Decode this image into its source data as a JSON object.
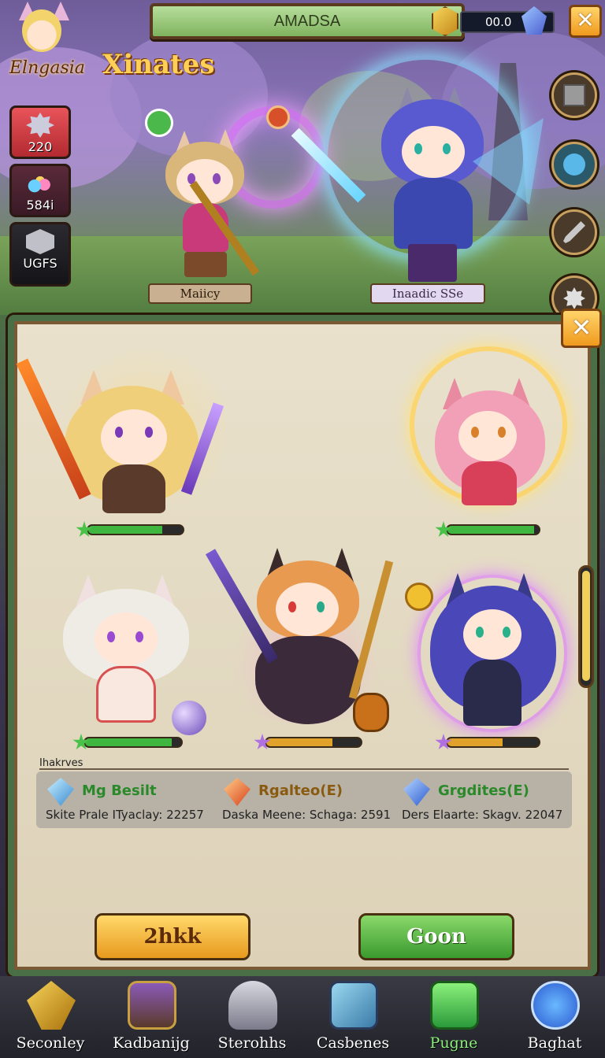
{
  "header": {
    "title": "AMADSA",
    "currency": "00.0",
    "logo_text": "Elngasia",
    "game_title": "Xinates"
  },
  "stats": [
    {
      "icon": "gear-icon",
      "value": "220"
    },
    {
      "icon": "gem-pile-icon",
      "value": "584i"
    },
    {
      "icon": "crystal-cube-icon",
      "value": "UGFS"
    }
  ],
  "top_heroes": [
    {
      "name": "Maiicy"
    },
    {
      "name": "Inaadic SSe"
    }
  ],
  "roster": {
    "heroes": [
      {
        "hp": 0.78,
        "color": "#3fb63f",
        "star": "#4ac24a"
      },
      {
        "hp": 0.95,
        "color": "#3fb63f",
        "star": "#4ac24a"
      },
      {
        "hp": 0.9,
        "color": "#3fb63f",
        "star": "#4ac24a"
      },
      {
        "hp": 0.7,
        "color": "#e0a22a",
        "star": "#b070e0"
      },
      {
        "hp": 0.6,
        "color": "#e0a22a",
        "star": "#b070e0"
      }
    ],
    "section_label": "Ihakrves",
    "info": [
      {
        "icon": "blue-crystal-icon",
        "title": "Mg Besilt",
        "sub": "Skite Prale ITyaclay: 22257"
      },
      {
        "icon": "orange-crystal-icon",
        "title": "Rgalteo(E)",
        "sub": "Daska Meene: Schaga: 2591"
      },
      {
        "icon": "blue-crystal-icon",
        "title": "Grgdites(E)",
        "sub": "Ders Elaarte: Skagv. 22047"
      }
    ],
    "left_button": "2hkk",
    "right_button": "Goon"
  },
  "nav": [
    {
      "label": "Seconley"
    },
    {
      "label": "Kadbanijg"
    },
    {
      "label": "Sterohhs"
    },
    {
      "label": "Casbenes"
    },
    {
      "label": "Pugne",
      "active": true
    },
    {
      "label": "Baghat"
    }
  ],
  "colors": {
    "panel_border": "#4a6e46",
    "accent_gold": "#ffcf56",
    "button_yellow": "#f3b62e",
    "button_green": "#5cb845"
  }
}
